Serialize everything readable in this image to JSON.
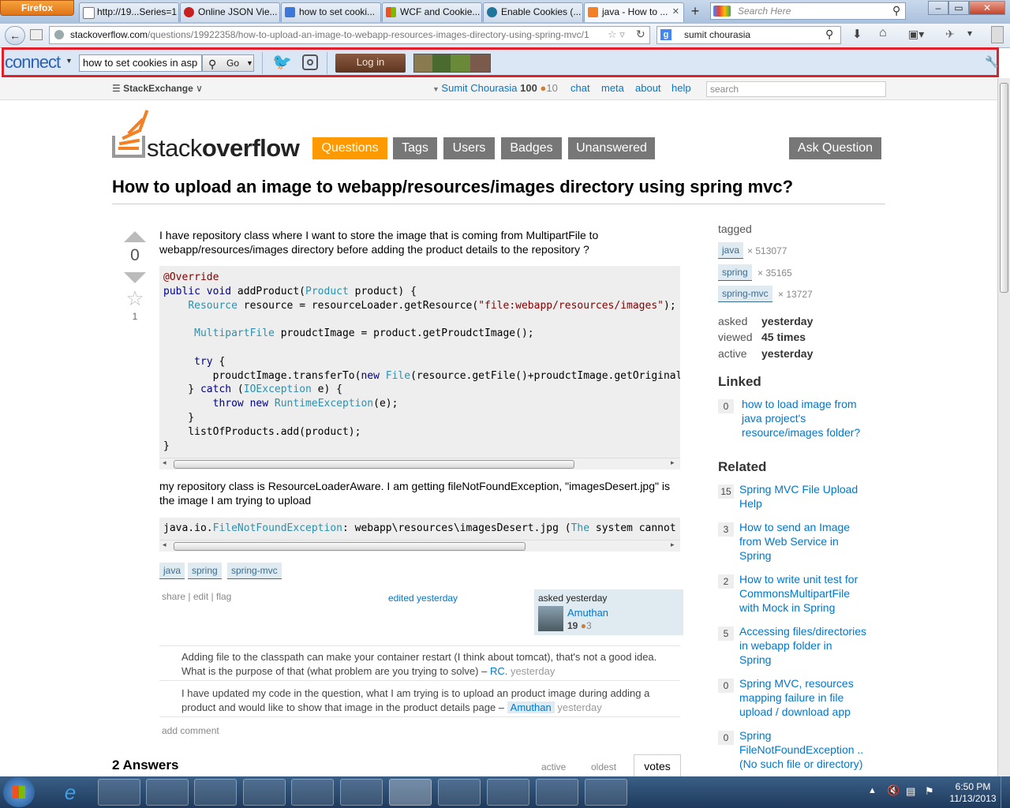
{
  "browser": {
    "menu_button": "Firefox",
    "tabs": [
      {
        "label": "http://19...Series=1",
        "active": false
      },
      {
        "label": "Online JSON Vie...",
        "active": false
      },
      {
        "label": "how to set cooki...",
        "active": false
      },
      {
        "label": "WCF and Cookie...",
        "active": false
      },
      {
        "label": "Enable Cookies (...",
        "active": false
      },
      {
        "label": "java - How to ...",
        "active": true
      }
    ],
    "new_tab": "+",
    "search_placeholder": "Search Here",
    "url_domain": "stackoverflow.com",
    "url_path": "/questions/19922358/how-to-upload-an-image-to-webapp-resources-images-directory-using-spring-mvc/1",
    "google_search_value": "sumit chourasia"
  },
  "connect_toolbar": {
    "logo": "connect",
    "search_value": "how to set cookies in asp",
    "go_label": "Go",
    "login_label": "Log in"
  },
  "se_bar": {
    "brand_a": "Stack",
    "brand_b": "Exchange",
    "user_name": "Sumit Chourasia",
    "reputation": "100",
    "bronze": "10",
    "links": [
      "chat",
      "meta",
      "about",
      "help"
    ],
    "search_placeholder": "search"
  },
  "site": {
    "logo_a": "stack",
    "logo_b": "overflow",
    "nav": [
      "Questions",
      "Tags",
      "Users",
      "Badges",
      "Unanswered"
    ],
    "ask_button": "Ask Question"
  },
  "question": {
    "title": "How to upload an image to webapp/resources/images directory using spring mvc?",
    "votes": "0",
    "favorites": "1",
    "body_1_line1": "I have repository class where I want to store the image that is coming from MultipartFile to",
    "body_1_line2": "webapp/resources/images directory before adding the product details to the repository ?",
    "body_2_line1": "my repository class is ResourceLoaderAware. I am getting fileNotFoundException, \"imagesDesert.jpg\" is",
    "body_2_line2": "the image I am trying to upload",
    "tags": [
      "java",
      "spring",
      "spring-mvc"
    ],
    "actions": [
      "share",
      "edit",
      "flag"
    ],
    "edited": "edited yesterday",
    "asked_label": "asked yesterday",
    "author": "Amuthan",
    "author_rep": "19",
    "author_bronze": "3",
    "comments": [
      {
        "line1": "Adding file to the classpath can make your container restart (I think about tomcat), that's not a good idea.",
        "line2": "What is the purpose of that (what problem are you trying to solve) –",
        "user": "RC.",
        "time": "yesterday"
      },
      {
        "line1": "I have updated my code in the question, what I am trying is to upload an product image during adding a",
        "line2": "product and would like to show that image in the product details page –",
        "user": "Amuthan",
        "time": "yesterday"
      }
    ],
    "add_comment": "add comment"
  },
  "answers": {
    "heading": "2 Answers",
    "sort_tabs": [
      "active",
      "oldest",
      "votes"
    ]
  },
  "sidebar": {
    "tagged_label": "tagged",
    "tags": [
      {
        "name": "java",
        "count": "× 513077"
      },
      {
        "name": "spring",
        "count": "× 35165"
      },
      {
        "name": "spring-mvc",
        "count": "× 13727"
      }
    ],
    "stats": [
      {
        "label": "asked",
        "value": "yesterday"
      },
      {
        "label": "viewed",
        "value": "45 times"
      },
      {
        "label": "active",
        "value": "yesterday"
      }
    ],
    "linked_heading": "Linked",
    "linked": [
      {
        "count": "0",
        "lines": [
          "how to load image from",
          "java project's",
          "resource/images folder?"
        ]
      }
    ],
    "related_heading": "Related",
    "related": [
      {
        "count": "15",
        "lines": [
          "Spring MVC File Upload",
          "Help"
        ]
      },
      {
        "count": "3",
        "lines": [
          "How to send an Image",
          "from Web Service in",
          "Spring"
        ]
      },
      {
        "count": "2",
        "lines": [
          "How to write unit test for",
          "CommonsMultipartFile",
          "with Mock in Spring"
        ]
      },
      {
        "count": "5",
        "lines": [
          "Accessing files/directories",
          "in webapp folder in",
          "Spring"
        ]
      },
      {
        "count": "0",
        "lines": [
          "Spring MVC, resources",
          "mapping failure in file",
          "upload / download app"
        ]
      },
      {
        "count": "0",
        "lines": [
          "Spring",
          "FileNotFoundException ..",
          "(No such file or directory)"
        ]
      }
    ]
  },
  "taskbar": {
    "time": "6:50 PM",
    "date": "11/13/2013"
  }
}
